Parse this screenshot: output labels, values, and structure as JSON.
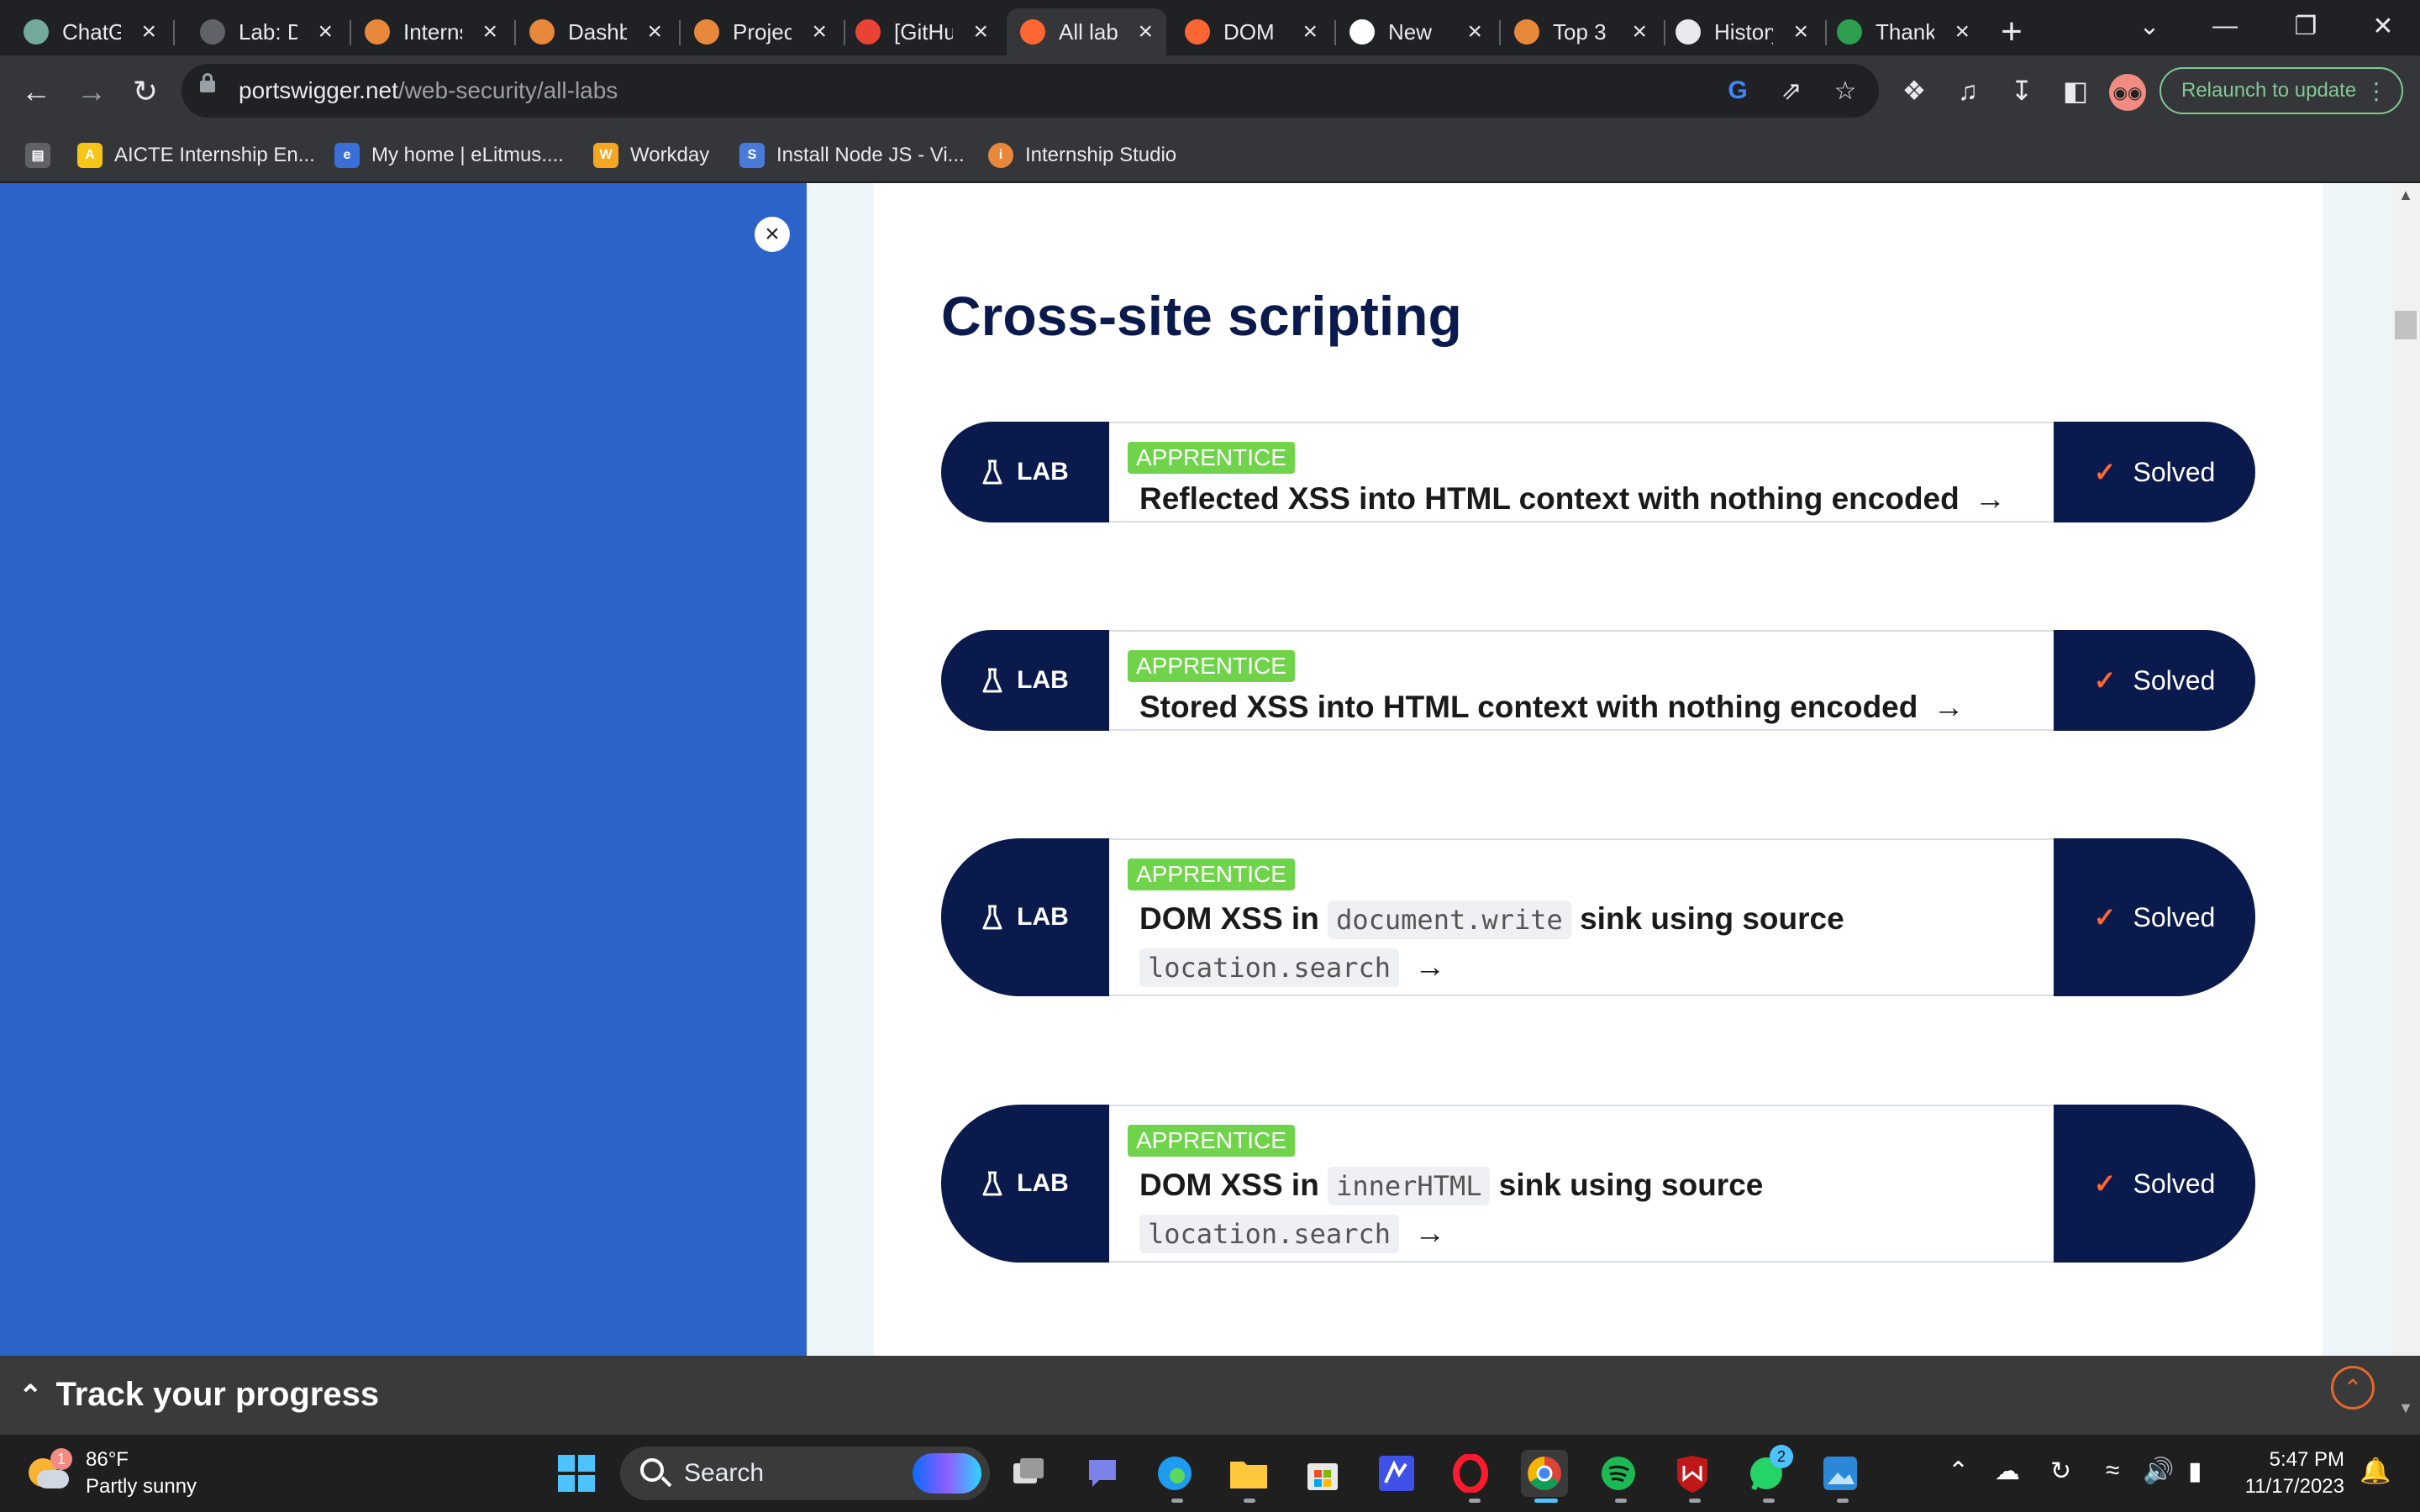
{
  "browser": {
    "tabs": [
      {
        "title": "ChatGPT",
        "icon": "chatgpt-icon",
        "color": "#74aa9c"
      },
      {
        "title": "Lab: DOM",
        "icon": "globe-icon",
        "color": "#5f6368"
      },
      {
        "title": "Internshala",
        "icon": "internshala-icon",
        "color": "#e8883a"
      },
      {
        "title": "Dashboard",
        "icon": "internshala-icon",
        "color": "#e8883a"
      },
      {
        "title": "Projects",
        "icon": "internshala-icon",
        "color": "#e8883a"
      },
      {
        "title": "[GitHub]",
        "icon": "gmail-icon",
        "color": "#ea4335"
      },
      {
        "title": "All labs",
        "icon": "portswigger-icon",
        "color": "#ff6633"
      },
      {
        "title": "DOM",
        "icon": "portswigger-icon",
        "color": "#ff6633"
      },
      {
        "title": "New",
        "icon": "github-icon",
        "color": "#ffffff"
      },
      {
        "title": "Top 3",
        "icon": "bookmark-icon",
        "color": "#e8883a"
      },
      {
        "title": "History",
        "icon": "history-icon",
        "color": "#e8eaed"
      },
      {
        "title": "Thanks",
        "icon": "check-shield-icon",
        "color": "#2e9e4f"
      }
    ],
    "url_host": "portswigger.net",
    "url_path": "/web-security/all-labs",
    "relaunch_label": "Relaunch to update",
    "bookmarks": [
      {
        "label": "AICTE Internship En...",
        "color": "#f5c518"
      },
      {
        "label": "My home | eLitmus....",
        "color": "#3b6fd8"
      },
      {
        "label": "Workday",
        "color": "#f5a623"
      },
      {
        "label": "Install Node JS - Vi...",
        "color": "#4a7bd8"
      },
      {
        "label": "Internship Studio",
        "color": "#e8883a"
      }
    ]
  },
  "page": {
    "section_title": "Cross-site scripting",
    "labs": [
      {
        "badge": "APPRENTICE",
        "lab_label": "LAB",
        "status": "Solved",
        "title": "Reflected XSS into HTML context with nothing encoded",
        "code1": "",
        "mid": "",
        "code2": ""
      },
      {
        "badge": "APPRENTICE",
        "lab_label": "LAB",
        "status": "Solved",
        "title": "Stored XSS into HTML context with nothing encoded",
        "code1": "",
        "mid": "",
        "code2": ""
      },
      {
        "badge": "APPRENTICE",
        "lab_label": "LAB",
        "status": "Solved",
        "title": "DOM XSS in",
        "code1": "document.write",
        "mid": "sink using source",
        "code2": "location.search"
      },
      {
        "badge": "APPRENTICE",
        "lab_label": "LAB",
        "status": "Solved",
        "title": "DOM XSS in",
        "code1": "innerHTML",
        "mid": "sink using source",
        "code2": "location.search"
      }
    ],
    "progress_title": "Track your progress"
  },
  "taskbar": {
    "temperature": "86°F",
    "weather": "Partly sunny",
    "weather_badge": "1",
    "search_label": "Search",
    "whatsapp_badge": "2",
    "time": "5:47 PM",
    "date": "11/17/2023"
  }
}
